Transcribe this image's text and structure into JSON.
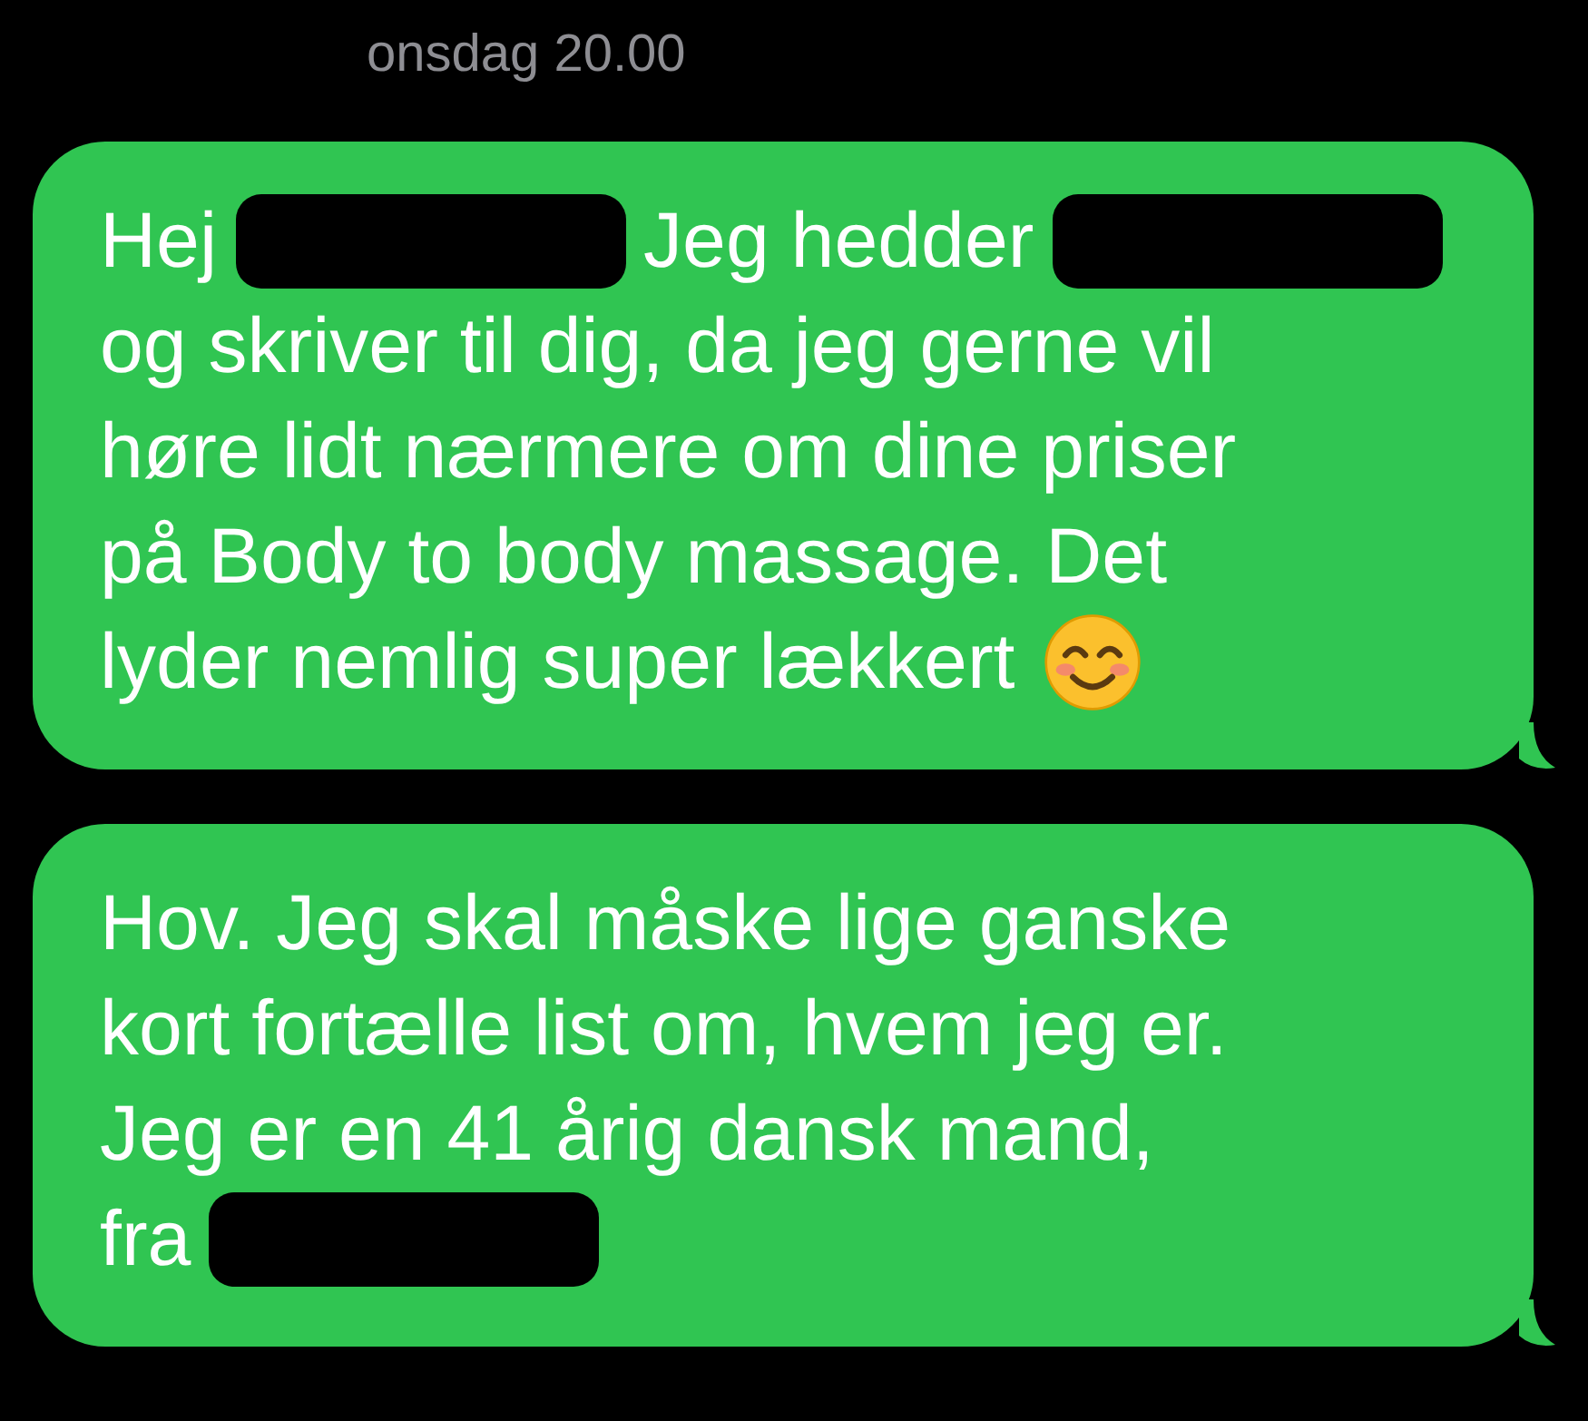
{
  "timestamp": "onsdag 20.00",
  "messages": [
    {
      "lines": [
        [
          {
            "kind": "text",
            "text": "Hej"
          },
          {
            "kind": "redacted"
          },
          {
            "kind": "text",
            "text": "Jeg hedder"
          },
          {
            "kind": "redacted"
          }
        ],
        [
          {
            "kind": "text",
            "text": "og skriver til dig, da jeg gerne vil"
          }
        ],
        [
          {
            "kind": "text",
            "text": "høre lidt nærmere om dine priser"
          }
        ],
        [
          {
            "kind": "text",
            "text": "på Body to body massage. Det"
          }
        ],
        [
          {
            "kind": "text",
            "text": "lyder nemlig super lækkert"
          },
          {
            "kind": "emoji"
          }
        ]
      ]
    },
    {
      "lines": [
        [
          {
            "kind": "text",
            "text": "Hov. Jeg skal måske lige ganske"
          }
        ],
        [
          {
            "kind": "text",
            "text": "kort fortælle list om, hvem jeg er."
          }
        ],
        [
          {
            "kind": "text",
            "text": "Jeg er en 41 årig dansk mand,"
          }
        ],
        [
          {
            "kind": "text",
            "text": "fra"
          },
          {
            "kind": "redacted"
          }
        ]
      ]
    }
  ]
}
